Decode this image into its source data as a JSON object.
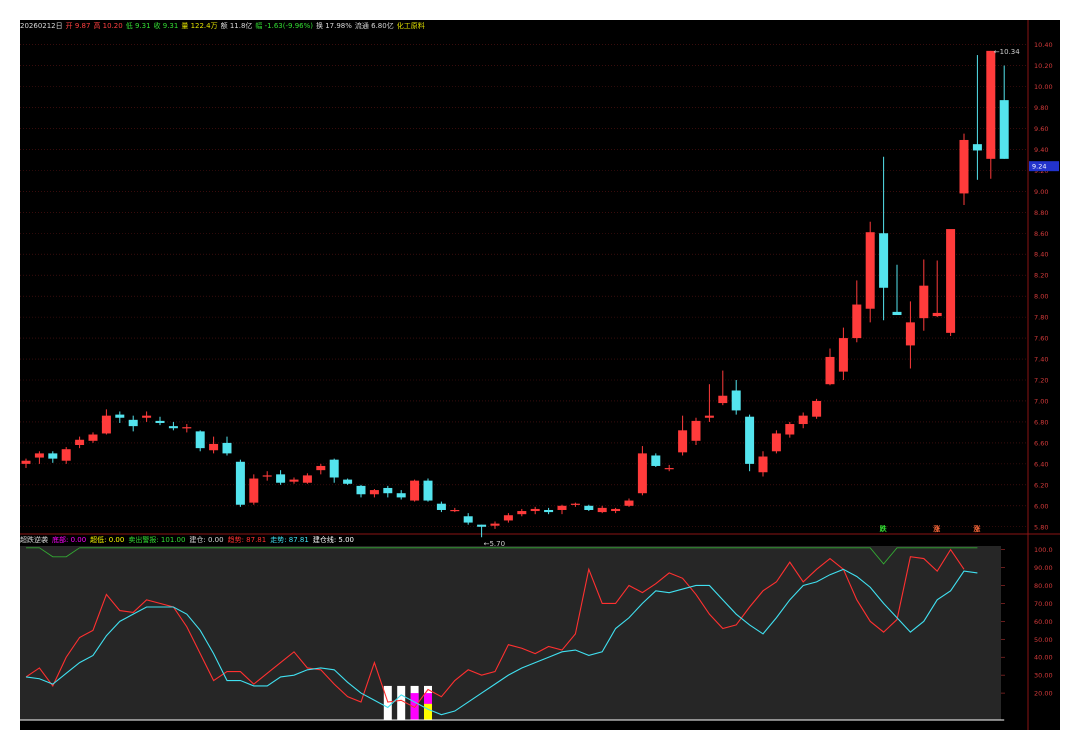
{
  "header": {
    "items": [
      {
        "text": "20260212日",
        "color": "#d8d8d8"
      },
      {
        "text": "开 9.87",
        "color": "#ff4040"
      },
      {
        "text": "高 10.20",
        "color": "#ff4040"
      },
      {
        "text": "低 9.31",
        "color": "#33dd33"
      },
      {
        "text": "收 9.31",
        "color": "#33dd33"
      },
      {
        "text": "量 122.4万",
        "color": "#e0e000"
      },
      {
        "text": "额 11.8亿",
        "color": "#d8d8d8"
      },
      {
        "text": "幅 -1.63(-9.96%)",
        "color": "#33dd33"
      },
      {
        "text": "换 17.98%",
        "color": "#d8d8d8"
      },
      {
        "text": "流通 6.80亿",
        "color": "#d8d8d8"
      },
      {
        "text": "化工原料",
        "color": "#e0e000"
      }
    ]
  },
  "indicator_header": {
    "items": [
      {
        "text": "超跌逆袭",
        "color": "#d8d8d8"
      },
      {
        "text": "底部: 0.00",
        "color": "#ff00ff"
      },
      {
        "text": "超低: 0.00",
        "color": "#ffff00"
      },
      {
        "text": "卖出警报: 101.00",
        "color": "#33dd33"
      },
      {
        "text": "建仓: 0.00",
        "color": "#d8d8d8"
      },
      {
        "text": "趋势: 87.81",
        "color": "#ff3030"
      },
      {
        "text": "走势: 87.81",
        "color": "#40e0f0"
      },
      {
        "text": "建仓线: 5.00",
        "color": "#ffffff"
      }
    ]
  },
  "chart_data": [
    {
      "type": "candlestick",
      "title": "",
      "ylim": [
        5.75,
        10.52
      ],
      "y_ticks": [
        "10.40",
        "10.20",
        "10.00",
        "9.80",
        "9.60",
        "9.40",
        "9.20",
        "9.00",
        "8.80",
        "8.60",
        "8.40",
        "8.20",
        "8.00",
        "7.80",
        "7.60",
        "7.40",
        "7.20",
        "7.00",
        "6.80",
        "6.60",
        "6.40",
        "6.20",
        "6.00",
        "5.80"
      ],
      "current_price": "9.24",
      "annotations": {
        "low_label": "5.70",
        "high_label": "10.34"
      },
      "signals": [
        {
          "index": 64,
          "text": "跌"
        },
        {
          "index": 68,
          "text": "涨"
        },
        {
          "index": 71,
          "text": "涨"
        }
      ],
      "candles": [
        {
          "o": 6.4,
          "h": 6.45,
          "l": 6.36,
          "c": 6.43
        },
        {
          "o": 6.46,
          "h": 6.52,
          "l": 6.4,
          "c": 6.5
        },
        {
          "o": 6.5,
          "h": 6.52,
          "l": 6.41,
          "c": 6.45
        },
        {
          "o": 6.43,
          "h": 6.56,
          "l": 6.4,
          "c": 6.54
        },
        {
          "o": 6.58,
          "h": 6.66,
          "l": 6.55,
          "c": 6.63
        },
        {
          "o": 6.62,
          "h": 6.7,
          "l": 6.6,
          "c": 6.68
        },
        {
          "o": 6.69,
          "h": 6.92,
          "l": 6.68,
          "c": 6.86
        },
        {
          "o": 6.87,
          "h": 6.9,
          "l": 6.79,
          "c": 6.84
        },
        {
          "o": 6.82,
          "h": 6.86,
          "l": 6.71,
          "c": 6.76
        },
        {
          "o": 6.84,
          "h": 6.9,
          "l": 6.8,
          "c": 6.86
        },
        {
          "o": 6.81,
          "h": 6.85,
          "l": 6.77,
          "c": 6.79
        },
        {
          "o": 6.76,
          "h": 6.8,
          "l": 6.72,
          "c": 6.74
        },
        {
          "o": 6.75,
          "h": 6.78,
          "l": 6.7,
          "c": 6.75
        },
        {
          "o": 6.71,
          "h": 6.72,
          "l": 6.52,
          "c": 6.55
        },
        {
          "o": 6.53,
          "h": 6.66,
          "l": 6.5,
          "c": 6.59
        },
        {
          "o": 6.6,
          "h": 6.66,
          "l": 6.48,
          "c": 6.5
        },
        {
          "o": 6.42,
          "h": 6.44,
          "l": 5.99,
          "c": 6.01
        },
        {
          "o": 6.03,
          "h": 6.3,
          "l": 6.01,
          "c": 6.26
        },
        {
          "o": 6.29,
          "h": 6.33,
          "l": 6.24,
          "c": 6.29
        },
        {
          "o": 6.3,
          "h": 6.34,
          "l": 6.2,
          "c": 6.22
        },
        {
          "o": 6.23,
          "h": 6.27,
          "l": 6.21,
          "c": 6.25
        },
        {
          "o": 6.22,
          "h": 6.31,
          "l": 6.21,
          "c": 6.29
        },
        {
          "o": 6.34,
          "h": 6.4,
          "l": 6.3,
          "c": 6.38
        },
        {
          "o": 6.44,
          "h": 6.45,
          "l": 6.22,
          "c": 6.27
        },
        {
          "o": 6.25,
          "h": 6.26,
          "l": 6.2,
          "c": 6.21
        },
        {
          "o": 6.19,
          "h": 6.2,
          "l": 6.08,
          "c": 6.11
        },
        {
          "o": 6.11,
          "h": 6.16,
          "l": 6.08,
          "c": 6.15
        },
        {
          "o": 6.17,
          "h": 6.19,
          "l": 6.08,
          "c": 6.12
        },
        {
          "o": 6.12,
          "h": 6.15,
          "l": 6.06,
          "c": 6.08
        },
        {
          "o": 6.05,
          "h": 6.25,
          "l": 6.04,
          "c": 6.24
        },
        {
          "o": 6.24,
          "h": 6.26,
          "l": 6.04,
          "c": 6.05
        },
        {
          "o": 6.02,
          "h": 6.04,
          "l": 5.94,
          "c": 5.96
        },
        {
          "o": 5.96,
          "h": 5.98,
          "l": 5.94,
          "c": 5.96
        },
        {
          "o": 5.9,
          "h": 5.93,
          "l": 5.82,
          "c": 5.84
        },
        {
          "o": 5.82,
          "h": 5.82,
          "l": 5.7,
          "c": 5.8
        },
        {
          "o": 5.81,
          "h": 5.85,
          "l": 5.78,
          "c": 5.83
        },
        {
          "o": 5.86,
          "h": 5.93,
          "l": 5.84,
          "c": 5.91
        },
        {
          "o": 5.92,
          "h": 5.97,
          "l": 5.9,
          "c": 5.95
        },
        {
          "o": 5.95,
          "h": 5.99,
          "l": 5.92,
          "c": 5.97
        },
        {
          "o": 5.96,
          "h": 5.98,
          "l": 5.92,
          "c": 5.94
        },
        {
          "o": 5.96,
          "h": 6.01,
          "l": 5.92,
          "c": 6.0
        },
        {
          "o": 6.01,
          "h": 6.03,
          "l": 5.99,
          "c": 6.02
        },
        {
          "o": 6.0,
          "h": 6.01,
          "l": 5.95,
          "c": 5.96
        },
        {
          "o": 5.94,
          "h": 6.0,
          "l": 5.93,
          "c": 5.98
        },
        {
          "o": 5.95,
          "h": 5.98,
          "l": 5.93,
          "c": 5.97
        },
        {
          "o": 6.0,
          "h": 6.07,
          "l": 5.99,
          "c": 6.05
        },
        {
          "o": 6.12,
          "h": 6.57,
          "l": 6.1,
          "c": 6.5
        },
        {
          "o": 6.48,
          "h": 6.5,
          "l": 6.37,
          "c": 6.38
        },
        {
          "o": 6.36,
          "h": 6.39,
          "l": 6.33,
          "c": 6.36
        },
        {
          "o": 6.51,
          "h": 6.86,
          "l": 6.48,
          "c": 6.72
        },
        {
          "o": 6.62,
          "h": 6.84,
          "l": 6.58,
          "c": 6.81
        },
        {
          "o": 6.84,
          "h": 7.16,
          "l": 6.8,
          "c": 6.86
        },
        {
          "o": 6.98,
          "h": 7.29,
          "l": 6.96,
          "c": 7.05
        },
        {
          "o": 7.1,
          "h": 7.2,
          "l": 6.87,
          "c": 6.91
        },
        {
          "o": 6.85,
          "h": 6.87,
          "l": 6.33,
          "c": 6.4
        },
        {
          "o": 6.32,
          "h": 6.52,
          "l": 6.28,
          "c": 6.47
        },
        {
          "o": 6.52,
          "h": 6.72,
          "l": 6.5,
          "c": 6.69
        },
        {
          "o": 6.68,
          "h": 6.8,
          "l": 6.65,
          "c": 6.78
        },
        {
          "o": 6.78,
          "h": 6.89,
          "l": 6.74,
          "c": 6.86
        },
        {
          "o": 6.85,
          "h": 7.02,
          "l": 6.83,
          "c": 7.0
        },
        {
          "o": 7.16,
          "h": 7.5,
          "l": 7.15,
          "c": 7.42
        },
        {
          "o": 7.28,
          "h": 7.7,
          "l": 7.2,
          "c": 7.6
        },
        {
          "o": 7.6,
          "h": 8.15,
          "l": 7.56,
          "c": 7.92
        },
        {
          "o": 7.88,
          "h": 8.71,
          "l": 7.75,
          "c": 8.61
        },
        {
          "o": 8.6,
          "h": 9.33,
          "l": 7.77,
          "c": 8.08
        },
        {
          "o": 7.85,
          "h": 8.3,
          "l": 7.83,
          "c": 7.82
        },
        {
          "o": 7.53,
          "h": 7.95,
          "l": 7.31,
          "c": 7.75
        },
        {
          "o": 7.79,
          "h": 8.35,
          "l": 7.67,
          "c": 8.1
        },
        {
          "o": 7.81,
          "h": 8.34,
          "l": 7.8,
          "c": 7.84
        },
        {
          "o": 7.65,
          "h": 8.45,
          "l": 7.62,
          "c": 8.64
        },
        {
          "o": 8.98,
          "h": 9.55,
          "l": 8.87,
          "c": 9.49
        },
        {
          "o": 9.45,
          "h": 10.3,
          "l": 9.11,
          "c": 9.39
        },
        {
          "o": 9.31,
          "h": 10.34,
          "l": 9.12,
          "c": 10.34
        },
        {
          "o": 9.87,
          "h": 10.2,
          "l": 9.31,
          "c": 9.31
        }
      ]
    },
    {
      "type": "line",
      "title": "超跌逆袭",
      "ylim": [
        5,
        102
      ],
      "y_ticks": [
        "100.0",
        "90.00",
        "80.00",
        "70.00",
        "60.00",
        "50.00",
        "40.00",
        "30.00",
        "20.00"
      ],
      "series": [
        {
          "name": "趋势",
          "color": "#ff3030",
          "values": [
            29,
            34,
            24,
            40,
            51,
            55,
            75,
            66,
            65,
            72,
            70,
            68,
            57,
            42,
            27,
            32,
            32,
            25,
            31,
            37,
            43,
            34,
            33,
            25,
            18,
            15,
            37,
            15,
            16,
            12,
            22,
            18,
            27,
            33,
            30,
            32,
            47,
            45,
            42,
            46,
            44,
            53,
            89,
            70,
            70,
            80,
            76,
            81,
            87,
            84,
            75,
            64,
            56,
            58,
            68,
            77,
            82,
            93,
            82,
            89,
            95,
            89,
            72,
            60,
            54,
            61,
            96,
            95,
            88,
            100,
            89
          ]
        },
        {
          "name": "走势",
          "color": "#40e0f0",
          "values": [
            29,
            28,
            25,
            31,
            37,
            41,
            52,
            60,
            64,
            68,
            68,
            68,
            64,
            55,
            42,
            27,
            27,
            24,
            24,
            29,
            30,
            33,
            34,
            33,
            26,
            20,
            16,
            12,
            19,
            15,
            11,
            8,
            10,
            15,
            20,
            25,
            30,
            34,
            37,
            40,
            43,
            44,
            41,
            43,
            56,
            62,
            70,
            77,
            76,
            78,
            80,
            80,
            72,
            64,
            58,
            53,
            62,
            72,
            80,
            82,
            86,
            89,
            85,
            79,
            70,
            62,
            54,
            60,
            72,
            77,
            88,
            87
          ]
        },
        {
          "name": "卖出警报",
          "color": "#33aa33",
          "values": [
            101,
            101,
            96,
            96,
            101,
            101,
            101,
            101,
            101,
            101,
            101,
            101,
            101,
            101,
            101,
            101,
            101,
            101,
            101,
            101,
            101,
            101,
            101,
            101,
            101,
            101,
            101,
            101,
            101,
            101,
            101,
            101,
            101,
            101,
            101,
            101,
            101,
            101,
            101,
            101,
            101,
            101,
            101,
            101,
            101,
            101,
            101,
            101,
            101,
            101,
            101,
            101,
            101,
            101,
            101,
            101,
            101,
            101,
            101,
            101,
            101,
            101,
            101,
            101,
            92,
            101,
            101,
            101,
            101,
            101,
            101,
            101
          ]
        }
      ],
      "baseline": {
        "name": "建仓线",
        "value": 5
      },
      "bars": [
        {
          "index": 27,
          "color": "#ffffff",
          "value": 24
        },
        {
          "index": 28,
          "color": "#ffffff",
          "value": 24
        },
        {
          "index": 29,
          "color": "#ffffff",
          "value": 24
        },
        {
          "index": 29,
          "color": "#ff00ff",
          "value": 20
        },
        {
          "index": 30,
          "color": "#ffffff",
          "value": 24
        },
        {
          "index": 30,
          "color": "#ff00ff",
          "value": 20
        },
        {
          "index": 30,
          "color": "#ffff00",
          "value": 14
        }
      ]
    }
  ],
  "colors": {
    "up": "#ff3b3b",
    "down": "#54e4ee",
    "grid_price": "#5a1414",
    "axis": "#8a1515",
    "price_tag_bg": "#2233cc",
    "indicator_bg": "#262626"
  }
}
